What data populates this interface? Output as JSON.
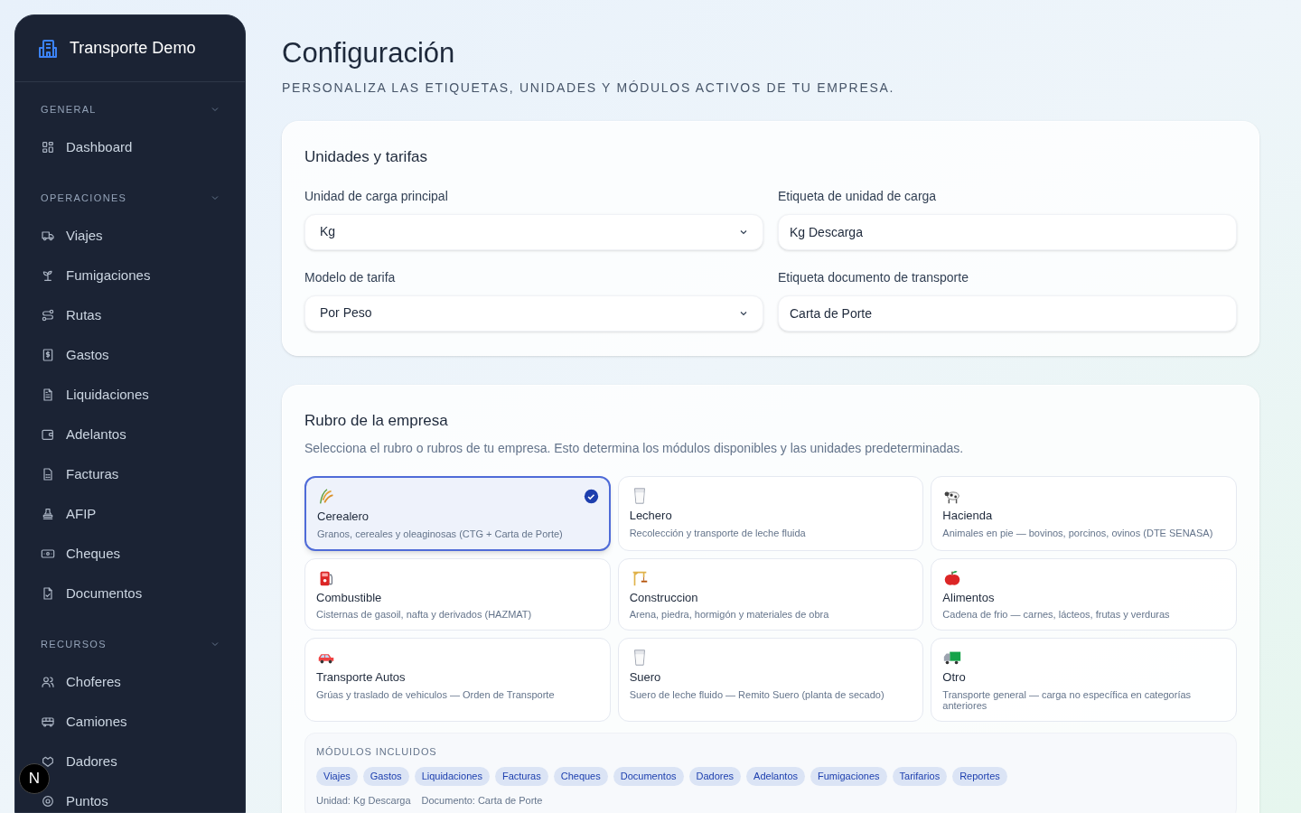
{
  "brand": {
    "name": "Transporte Demo"
  },
  "sidebar": {
    "sections": [
      {
        "title": "GENERAL",
        "expanded": true,
        "items": [
          {
            "label": "Dashboard",
            "selected": false
          }
        ]
      },
      {
        "title": "OPERACIONES",
        "expanded": true,
        "items": [
          {
            "label": "Viajes",
            "selected": false
          },
          {
            "label": "Fumigaciones",
            "selected": false
          },
          {
            "label": "Rutas",
            "selected": false
          },
          {
            "label": "Gastos",
            "selected": false
          },
          {
            "label": "Liquidaciones",
            "selected": false
          },
          {
            "label": "Adelantos",
            "selected": false
          },
          {
            "label": "Facturas",
            "selected": false
          },
          {
            "label": "AFIP",
            "selected": false
          },
          {
            "label": "Cheques",
            "selected": false
          },
          {
            "label": "Documentos",
            "selected": false
          }
        ]
      },
      {
        "title": "RECURSOS",
        "expanded": true,
        "items": [
          {
            "label": "Choferes",
            "selected": false
          },
          {
            "label": "Camiones",
            "selected": false
          },
          {
            "label": "Dadores",
            "selected": false
          },
          {
            "label": "Puntos",
            "selected": false
          }
        ]
      }
    ]
  },
  "dev_badge": {
    "label": "N"
  },
  "header": {
    "title": "Configuración",
    "subtitle": "PERSONALIZA LAS ETIQUETAS, UNIDADES Y MÓDULOS ACTIVOS DE TU EMPRESA."
  },
  "units_card": {
    "title": "Unidades y tarifas",
    "fields": [
      {
        "label": "Unidad de carga principal",
        "kind": "select",
        "value": "Kg"
      },
      {
        "label": "Etiqueta de unidad de carga",
        "kind": "input",
        "value": "Kg Descarga"
      },
      {
        "label": "Modelo de tarifa",
        "kind": "select",
        "value": "Por Peso"
      },
      {
        "label": "Etiqueta documento de transporte",
        "kind": "input",
        "value": "Carta de Porte"
      }
    ]
  },
  "rubro_card": {
    "title": "Rubro de la empresa",
    "description": "Selecciona el rubro o rubros de tu empresa. Esto determina los módulos disponibles y las unidades predeterminadas.",
    "options": [
      {
        "name": "Cerealero",
        "description": "Granos, cereales y oleaginosas (CTG + Carta de Porte)",
        "selected": true
      },
      {
        "name": "Lechero",
        "description": "Recolección y transporte de leche fluida",
        "selected": false
      },
      {
        "name": "Hacienda",
        "description": "Animales en pie — bovinos, porcinos, ovinos (DTE SENASA)",
        "selected": false
      },
      {
        "name": "Combustible",
        "description": "Cisternas de gasoil, nafta y derivados (HAZMAT)",
        "selected": false
      },
      {
        "name": "Construccion",
        "description": "Arena, piedra, hormigón y materiales de obra",
        "selected": false
      },
      {
        "name": "Alimentos",
        "description": "Cadena de frio — carnes, lácteos, frutas y verduras",
        "selected": false
      },
      {
        "name": "Transporte Autos",
        "description": "Grúas y traslado de vehiculos — Orden de Transporte",
        "selected": false
      },
      {
        "name": "Suero",
        "description": "Suero de leche fluido — Remito Suero (planta de secado)",
        "selected": false
      },
      {
        "name": "Otro",
        "description": "Transporte general — carga no específica en categorías anteriores",
        "selected": false
      }
    ],
    "modules": {
      "title": "MÓDULOS INCLUIDOS",
      "items": [
        "Viajes",
        "Gastos",
        "Liquidaciones",
        "Facturas",
        "Cheques",
        "Documentos",
        "Dadores",
        "Adelantos",
        "Fumigaciones",
        "Tarifarios",
        "Reportes"
      ],
      "notes": [
        "Unidad: Kg Descarga",
        "Documento: Carta de Porte"
      ]
    }
  }
}
